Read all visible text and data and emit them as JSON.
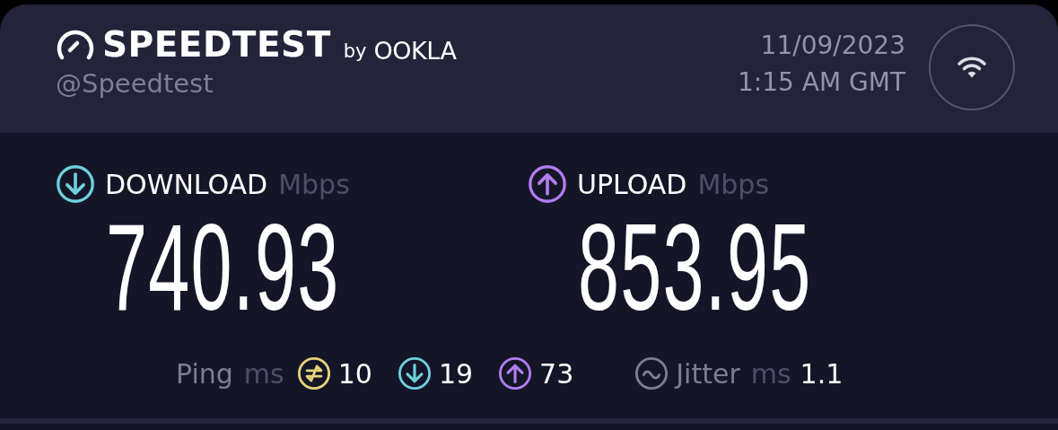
{
  "header": {
    "brand": "SPEEDTEST",
    "by": "by",
    "partner": "OOKLA",
    "handle": "@Speedtest",
    "date": "11/09/2023",
    "time": "1:15 AM GMT"
  },
  "results": [
    {
      "kind": "download",
      "label": "DOWNLOAD",
      "unit": "Mbps",
      "value": "740.93"
    },
    {
      "kind": "upload",
      "label": "UPLOAD",
      "unit": "Mbps",
      "value": "853.95"
    }
  ],
  "latency": {
    "label": "Ping",
    "unit": "ms",
    "readings": [
      {
        "kind": "idle",
        "value": "10"
      },
      {
        "kind": "download",
        "value": "19"
      },
      {
        "kind": "upload",
        "value": "73"
      }
    ]
  },
  "jitter": {
    "label": "Jitter",
    "unit": "ms",
    "value": "1.1"
  }
}
